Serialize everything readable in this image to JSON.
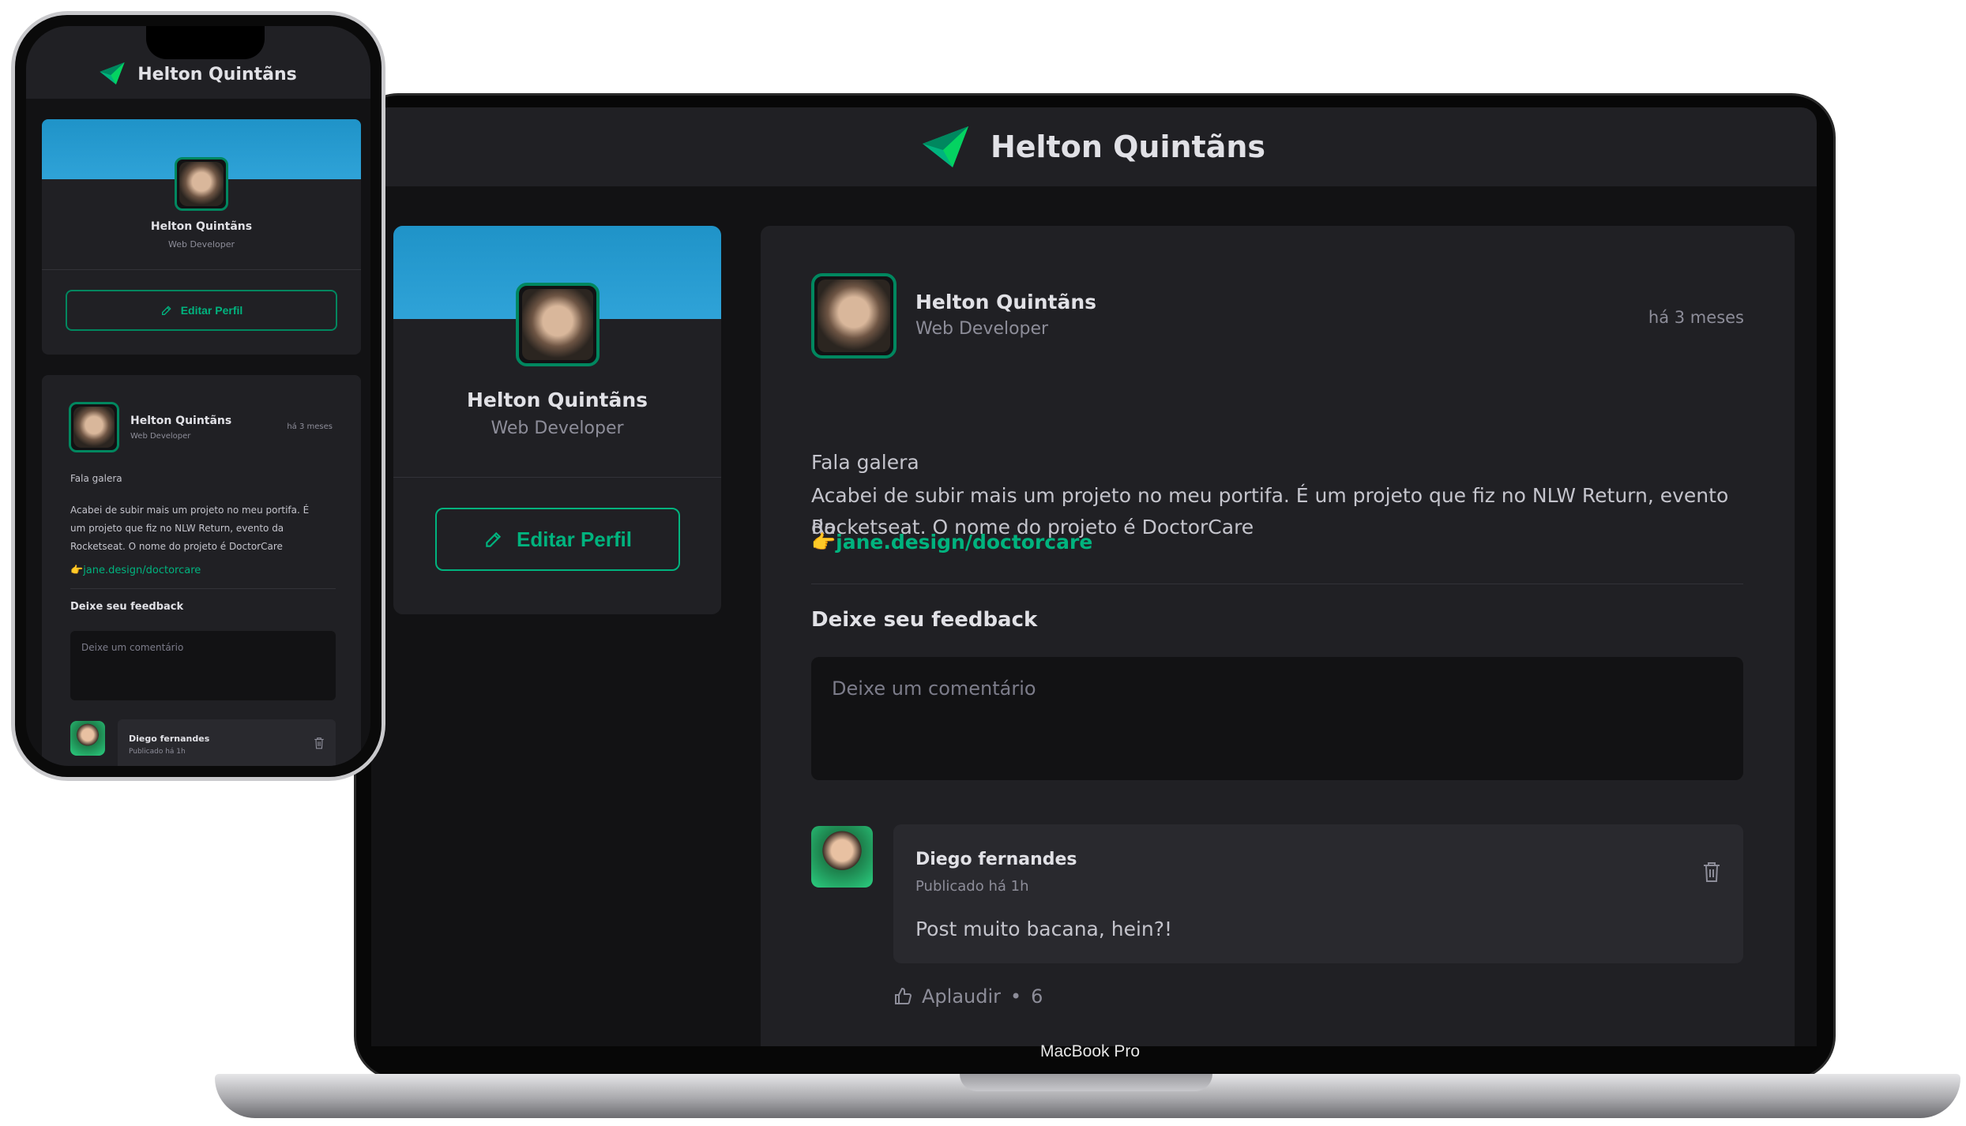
{
  "desktop": {
    "header": {
      "title": "Helton Quintãns"
    },
    "profile": {
      "name": "Helton Quintãns",
      "role": "Web Developer",
      "edit_label": "Editar Perfil"
    },
    "post": {
      "author": "Helton Quintãns",
      "role": "Web Developer",
      "time": "há 3 meses",
      "greeting": "Fala galera",
      "body_line1": "Acabei de subir mais um projeto no meu portifa. É um projeto que fiz no NLW Return, evento da",
      "body_line2": "Rocketseat. O nome do projeto é DoctorCare",
      "link_emoji": "👉",
      "link": "jane.design/doctorcare",
      "feedback_title": "Deixe seu feedback",
      "comment_placeholder": "Deixe um comentário"
    },
    "comment": {
      "author": "Diego fernandes",
      "time": "Publicado há 1h",
      "text": "Post muito bacana, hein?!",
      "applaud_label": "Aplaudir",
      "applaud_sep": "•",
      "applaud_count": "6"
    },
    "device_label": "MacBook Pro"
  },
  "mobile": {
    "header": {
      "title": "Helton Quintãns"
    },
    "profile": {
      "name": "Helton Quintãns",
      "role": "Web Developer",
      "edit_label": "Editar Perfil"
    },
    "post": {
      "author": "Helton Quintãns",
      "role": "Web Developer",
      "time": "há 3 meses",
      "greeting": "Fala galera",
      "body_line1": "Acabei de subir mais um projeto no meu portifa. É",
      "body_line2": "um projeto que fiz no NLW Return, evento da",
      "body_line3": "Rocketseat. O nome do projeto é DoctorCare",
      "link_emoji": "👉",
      "link": "jane.design/doctorcare",
      "feedback_title": "Deixe seu feedback",
      "comment_placeholder": "Deixe um comentário"
    },
    "comment": {
      "author": "Diego fernandes",
      "time": "Publicado há 1h"
    }
  },
  "colors": {
    "accent": "#00b37e",
    "accent_dark": "#00875f",
    "bg": "#121214",
    "card": "#202024",
    "comment_bg": "#29292e"
  },
  "icons": [
    "ignite-logo-icon",
    "pencil-icon",
    "trash-icon",
    "thumbs-up-icon"
  ]
}
